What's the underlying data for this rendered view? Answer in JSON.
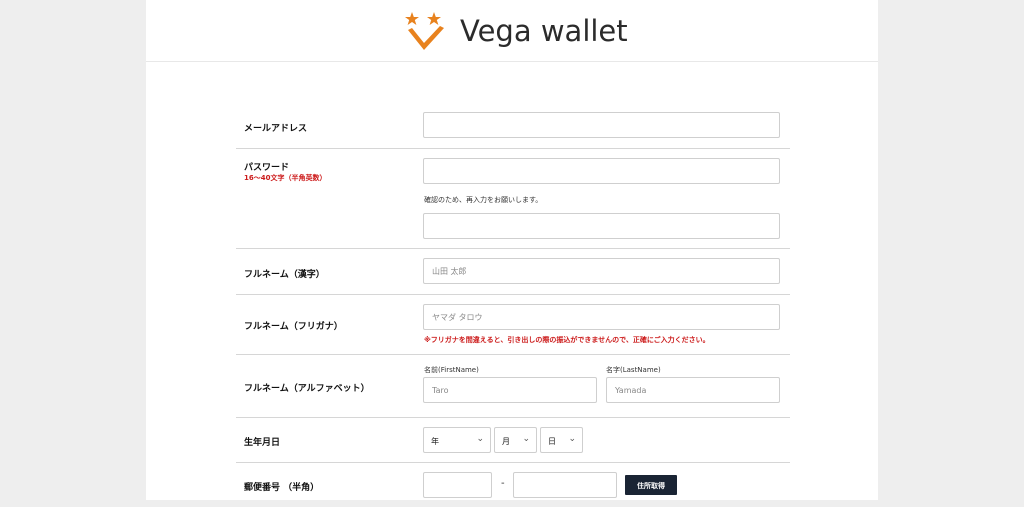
{
  "header": {
    "logo_text": "Vega wallet",
    "logo_colors": {
      "stars": "#e8821e",
      "check": "#e8821e"
    }
  },
  "form": {
    "email": {
      "label": "メールアドレス",
      "value": "",
      "placeholder": ""
    },
    "password": {
      "label": "パスワード",
      "sublabel": "16〜40文字（半角英数）",
      "value": "",
      "confirm_note": "確認のため、再入力をお願いします。",
      "confirm_value": ""
    },
    "fullname_kanji": {
      "label": "フルネーム（漢字）",
      "placeholder": "山田 太郎"
    },
    "fullname_kana": {
      "label": "フルネーム（フリガナ）",
      "placeholder": "ヤマダ タロウ",
      "warning": "※フリガナを間違えると、引き出しの際の振込ができませんので、正確にご入力ください。"
    },
    "fullname_alpha": {
      "label": "フルネーム（アルファベット）",
      "first_label": "名前(FirstName)",
      "first_placeholder": "Taro",
      "last_label": "名字(LastName)",
      "last_placeholder": "Yamada"
    },
    "birthdate": {
      "label": "生年月日",
      "year": "年",
      "month": "月",
      "day": "日"
    },
    "postal": {
      "label": "郵便番号 （半角）",
      "separator": "-",
      "button_label": "住所取得"
    }
  }
}
